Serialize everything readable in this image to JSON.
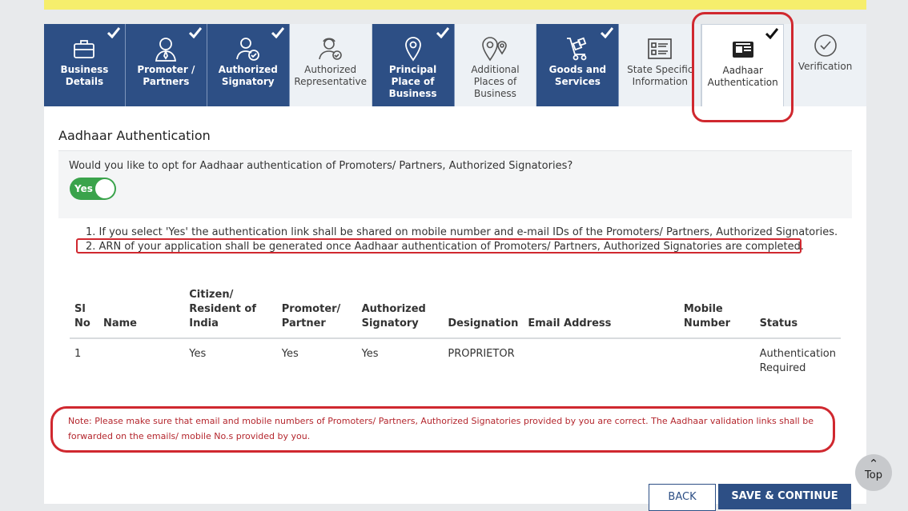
{
  "tabs": [
    {
      "label": "Business Details",
      "status": "done",
      "icon": "briefcase-icon"
    },
    {
      "label": "Promoter / Partners",
      "status": "done",
      "icon": "person-icon"
    },
    {
      "label": "Authorized Signatory",
      "status": "done",
      "icon": "signatory-icon"
    },
    {
      "label": "Authorized Representative",
      "status": "todo",
      "icon": "representative-icon"
    },
    {
      "label": "Principal Place of Business",
      "status": "done",
      "icon": "location-pin-icon"
    },
    {
      "label": "Additional Places of Business",
      "status": "todo",
      "icon": "multi-location-icon"
    },
    {
      "label": "Goods and Services",
      "status": "done",
      "icon": "cart-icon"
    },
    {
      "label": "State Specific Information",
      "status": "todo",
      "icon": "info-card-icon"
    },
    {
      "label": "Aadhaar Authentication",
      "status": "active",
      "icon": "id-card-icon"
    },
    {
      "label": "Verification",
      "status": "todo",
      "icon": "check-circle-icon"
    }
  ],
  "section": {
    "title": "Aadhaar Authentication"
  },
  "optin": {
    "question": "Would you like to opt for Aadhaar authentication of Promoters/ Partners, Authorized Signatories?",
    "toggle_label": "Yes",
    "toggle_on": true
  },
  "notes": [
    "1. If you select 'Yes' the authentication link shall be shared on mobile number and e-mail IDs of the Promoters/ Partners, Authorized Signatories.",
    "2. ARN of your application shall be generated once Aadhaar authentication of Promoters/ Partners, Authorized Signatories are completed."
  ],
  "table": {
    "headers": {
      "sl": [
        "Sl",
        "No"
      ],
      "name": "Name",
      "citizen": [
        "Citizen/",
        "Resident of",
        "India"
      ],
      "promoter": [
        "Promoter/",
        "Partner"
      ],
      "authorized": [
        "Authorized",
        "Signatory"
      ],
      "designation": "Designation",
      "email": "Email Address",
      "mobile": [
        "Mobile",
        "Number"
      ],
      "status": "Status"
    },
    "rows": [
      {
        "sl": "1",
        "name": "",
        "citizen": "Yes",
        "promoter": "Yes",
        "authorized": "Yes",
        "designation": "PROPRIETOR",
        "email": "",
        "mobile": "",
        "status": [
          "Authentication",
          "Required"
        ]
      }
    ]
  },
  "note_bottom": "Note: Please make sure that email and mobile numbers of Promoters/ Partners, Authorized Signatories provided by you are correct. The Aadhaar validation links shall be forwarded on the emails/ mobile No.s provided by you.",
  "buttons": {
    "back": "BACK",
    "save": "SAVE & CONTINUE"
  },
  "top_button": {
    "label": "Top"
  },
  "colors": {
    "done_tab": "#2d4f85",
    "highlight": "#d0282f",
    "toggle": "#3aa34b",
    "note": "#b4262d"
  }
}
